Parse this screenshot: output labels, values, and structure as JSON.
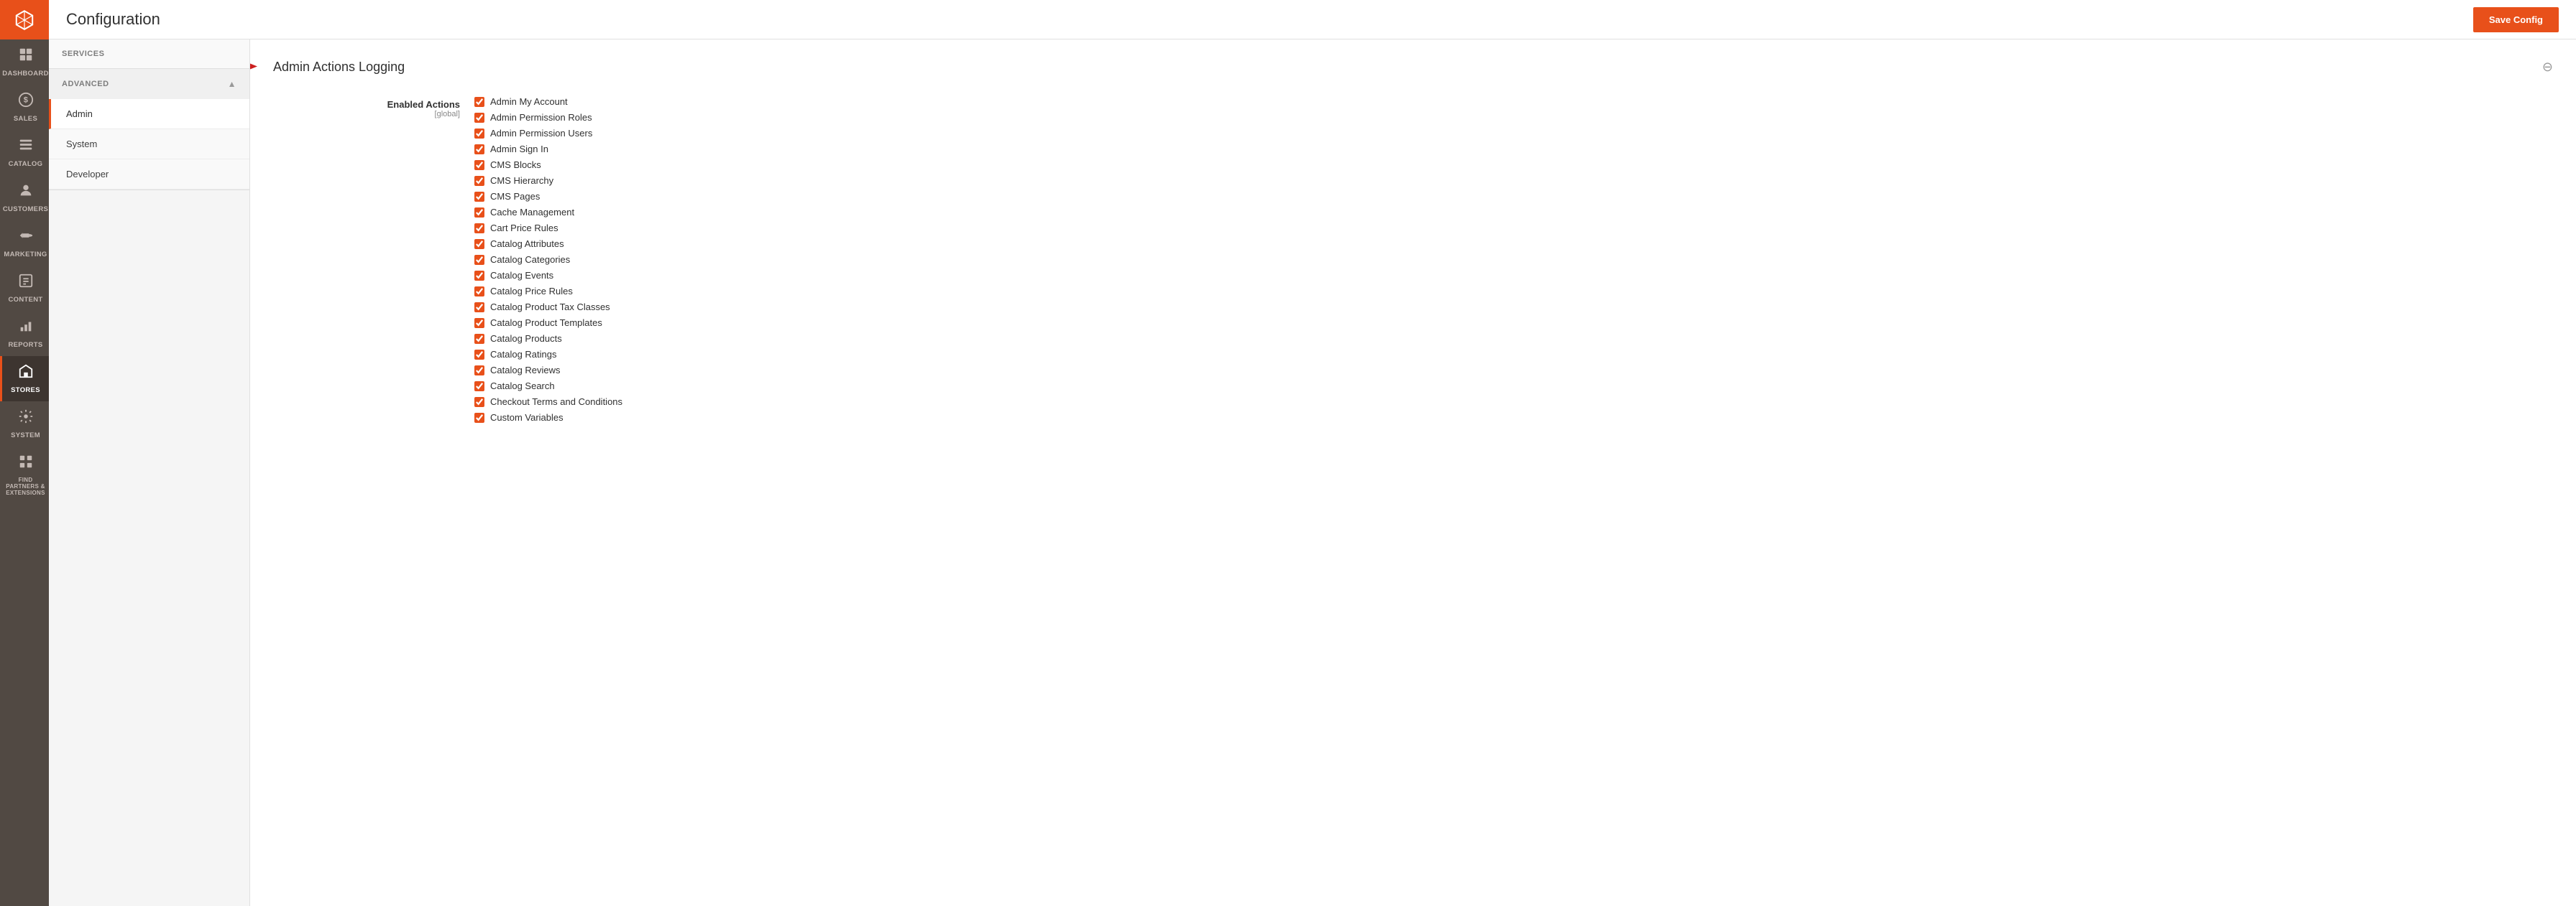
{
  "page": {
    "title": "Configuration",
    "save_button_label": "Save Config"
  },
  "sidebar": {
    "items": [
      {
        "id": "dashboard",
        "label": "DASHBOARD",
        "icon": "⊞"
      },
      {
        "id": "sales",
        "label": "SALES",
        "icon": "$"
      },
      {
        "id": "catalog",
        "label": "CATALOG",
        "icon": "▤"
      },
      {
        "id": "customers",
        "label": "CUSTOMERS",
        "icon": "👤"
      },
      {
        "id": "marketing",
        "label": "MARKETING",
        "icon": "📢"
      },
      {
        "id": "content",
        "label": "CONTENT",
        "icon": "⬜"
      },
      {
        "id": "reports",
        "label": "REPORTS",
        "icon": "📊"
      },
      {
        "id": "stores",
        "label": "STORES",
        "icon": "🏪"
      },
      {
        "id": "system",
        "label": "SYSTEM",
        "icon": "⚙"
      },
      {
        "id": "find",
        "label": "FIND PARTNERS & EXTENSIONS",
        "icon": "🧩"
      }
    ]
  },
  "left_panel": {
    "sections": [
      {
        "id": "services",
        "label": "SERVICES",
        "expanded": false,
        "items": []
      },
      {
        "id": "advanced",
        "label": "ADVANCED",
        "expanded": true,
        "items": [
          {
            "id": "admin",
            "label": "Admin",
            "active": true
          },
          {
            "id": "system",
            "label": "System",
            "active": false
          },
          {
            "id": "developer",
            "label": "Developer",
            "active": false
          }
        ]
      }
    ]
  },
  "main_content": {
    "section_title": "Admin Actions Logging",
    "enabled_actions_label": "Enabled Actions",
    "enabled_actions_scope": "[global]",
    "checkboxes": [
      {
        "id": "admin_my_account",
        "label": "Admin My Account",
        "checked": true
      },
      {
        "id": "admin_permission_roles",
        "label": "Admin Permission Roles",
        "checked": true
      },
      {
        "id": "admin_permission_users",
        "label": "Admin Permission Users",
        "checked": true
      },
      {
        "id": "admin_sign_in",
        "label": "Admin Sign In",
        "checked": true
      },
      {
        "id": "cms_blocks",
        "label": "CMS Blocks",
        "checked": true
      },
      {
        "id": "cms_hierarchy",
        "label": "CMS Hierarchy",
        "checked": true
      },
      {
        "id": "cms_pages",
        "label": "CMS Pages",
        "checked": true
      },
      {
        "id": "cache_management",
        "label": "Cache Management",
        "checked": true
      },
      {
        "id": "cart_price_rules",
        "label": "Cart Price Rules",
        "checked": true
      },
      {
        "id": "catalog_attributes",
        "label": "Catalog Attributes",
        "checked": true
      },
      {
        "id": "catalog_categories",
        "label": "Catalog Categories",
        "checked": true
      },
      {
        "id": "catalog_events",
        "label": "Catalog Events",
        "checked": true
      },
      {
        "id": "catalog_price_rules",
        "label": "Catalog Price Rules",
        "checked": true
      },
      {
        "id": "catalog_product_tax_classes",
        "label": "Catalog Product Tax Classes",
        "checked": true
      },
      {
        "id": "catalog_product_templates",
        "label": "Catalog Product Templates",
        "checked": true
      },
      {
        "id": "catalog_products",
        "label": "Catalog Products",
        "checked": true
      },
      {
        "id": "catalog_ratings",
        "label": "Catalog Ratings",
        "checked": true
      },
      {
        "id": "catalog_reviews",
        "label": "Catalog Reviews",
        "checked": true
      },
      {
        "id": "catalog_search",
        "label": "Catalog Search",
        "checked": true
      },
      {
        "id": "checkout_terms",
        "label": "Checkout Terms and Conditions",
        "checked": true
      },
      {
        "id": "custom_variables",
        "label": "Custom Variables",
        "checked": true
      }
    ]
  }
}
